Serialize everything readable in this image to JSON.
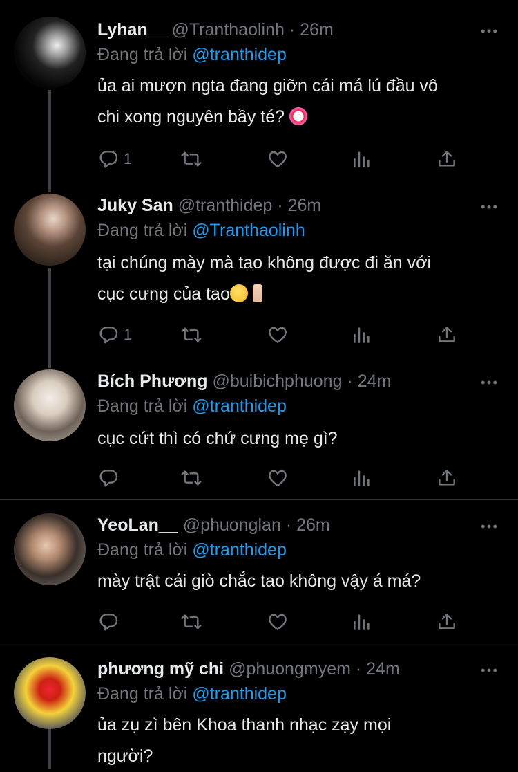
{
  "tweets": [
    {
      "name": "Lyhan__",
      "handle": "@Tranthaolinh",
      "dot": "·",
      "time": "26m",
      "reply_prefix": "Đang trả lời",
      "reply_to": "@tranthidep",
      "text_lines": [
        "ủa ai mượn ngta đang giỡn cái má lú đầu vô",
        "chi xong nguyên bầy té?"
      ],
      "emoji": "clown-emoji",
      "reply_count": "1"
    },
    {
      "name": "Juky San",
      "handle": "@tranthidep",
      "dot": "·",
      "time": "26m",
      "reply_prefix": "Đang trả lời",
      "reply_to": "@Tranthaolinh",
      "text_lines": [
        "tại chúng mày mà tao không được đi ăn với",
        "cục cưng của tao"
      ],
      "emoji": "smile-emoji middle-finger-emoji",
      "reply_count": "1"
    },
    {
      "name": "Bích Phương",
      "handle": "@buibichphuong",
      "dot": "·",
      "time": "24m",
      "reply_prefix": "Đang trả lời",
      "reply_to": "@tranthidep",
      "text_lines": [
        "cục cứt thì có chứ cưng mẹ gì?"
      ],
      "reply_count": ""
    },
    {
      "name": "YeoLan__",
      "handle": "@phuonglan",
      "dot": "·",
      "time": "26m",
      "reply_prefix": "Đang trả lời",
      "reply_to": "@tranthidep",
      "text_lines": [
        "mày trật cái giò chắc tao không vậy á má?"
      ],
      "reply_count": ""
    },
    {
      "name": "phương mỹ chi",
      "handle": "@phuongmyem",
      "dot": "·",
      "time": "24m",
      "reply_prefix": "Đang trả lời",
      "reply_to": "@tranthidep",
      "text_lines": [
        "ủa zụ zì bên Khoa thanh nhạc zạy mọi",
        "người?"
      ],
      "reply_count": ""
    }
  ],
  "icons": [
    "reply-icon",
    "retweet-icon",
    "like-icon",
    "views-icon",
    "share-icon",
    "more-icon"
  ],
  "colors": {
    "background": "#000000",
    "text": "#e7e9ea",
    "muted": "#71767b",
    "accent": "#1d9bf0",
    "divider": "#2f3336"
  }
}
